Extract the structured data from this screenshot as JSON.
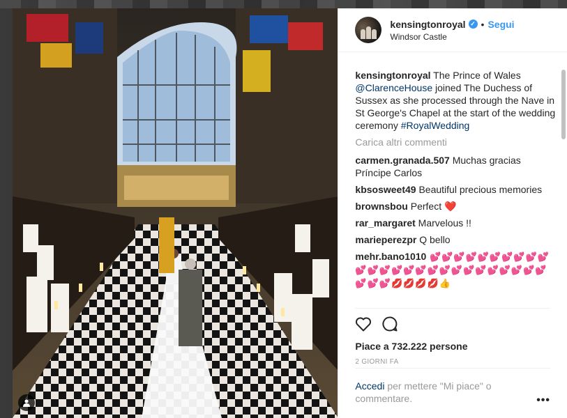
{
  "post": {
    "username": "kensingtonroyal",
    "verified_glyph": "✓",
    "separator": "•",
    "follow_label": "Segui",
    "location": "Windsor Castle",
    "caption_text": " The Prince of Wales ",
    "caption_mention": "@ClarenceHouse",
    "caption_rest": " joined The Duchess of Sussex as she processed through the Nave in St George's Chapel at the start of the wedding ceremony ",
    "caption_hashtag": "#RoyalWedding",
    "load_more_label": "Carica altri commenti",
    "comments": [
      {
        "user": "carmen.granada.507",
        "text": " Muchas gracias Príncipe Carlos"
      },
      {
        "user": "kbsosweet49",
        "text": " Beautiful precious memories"
      },
      {
        "user": "brownsbou",
        "text": " Perfect ❤️"
      },
      {
        "user": "rar_margaret",
        "text": " Marvelous !!"
      },
      {
        "user": "marieperezpr",
        "text": " Q bello"
      },
      {
        "user": "mehr.bano1010",
        "text": " 💕💕💕💕💕💕💕💕💕💕💕💕💕💕💕💕💕💕💕💕💕💕💕💕💕💕💕💕💕💋💋💋💋👍"
      }
    ],
    "likes_text": "Piace a 732.222 persone",
    "date_text": "2 giorni fa",
    "login_link": "Accedi",
    "login_rest": " per mettere \"Mi piace\" o commentare.",
    "more_label": "•••"
  },
  "icons": {
    "like": "heart-outline-icon",
    "comment": "speech-bubble-icon",
    "tag": "person-tag-icon"
  },
  "colors": {
    "accent": "#3897f0",
    "link": "#003569",
    "muted": "#999999",
    "text": "#262626"
  }
}
